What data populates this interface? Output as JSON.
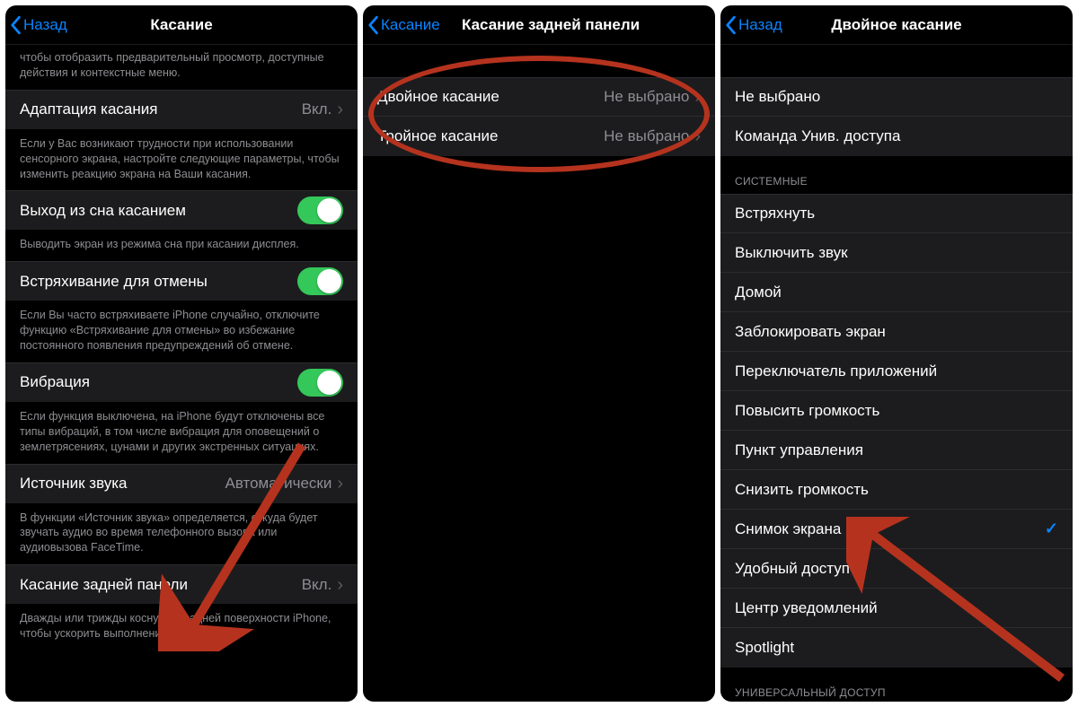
{
  "screen1": {
    "back": "Назад",
    "title": "Касание",
    "topFooter": "чтобы отобразить предварительный просмотр, доступные действия и контекстные меню.",
    "items": [
      {
        "label": "Адаптация касания",
        "value": "Вкл.",
        "footer": "Если у Вас возникают трудности при использовании сенсорного экрана, настройте следующие параметры, чтобы изменить реакцию экрана на Ваши касания."
      },
      {
        "label": "Выход из сна касанием",
        "toggle": true,
        "footer": "Выводить экран из режима сна при касании дисплея."
      },
      {
        "label": "Встряхивание для отмены",
        "toggle": true,
        "footer": "Если Вы часто встряхиваете iPhone случайно, отключите функцию «Встряхивание для отмены» во избежание постоянного появления предупреждений об отмене."
      },
      {
        "label": "Вибрация",
        "toggle": true,
        "footer": "Если функция выключена, на iPhone будут отключены все типы вибраций, в том числе вибрация для оповещений о землетрясениях, цунами и других экстренных ситуациях."
      },
      {
        "label": "Источник звука",
        "value": "Автоматически",
        "footer": "В функции «Источник звука» определяется, откуда будет звучать аудио во время телефонного вызова или аудиовызова FaceTime."
      },
      {
        "label": "Касание задней панели",
        "value": "Вкл.",
        "footer": "Дважды или трижды коснуться задней поверхности iPhone, чтобы ускорить выполнение действий."
      }
    ]
  },
  "screen2": {
    "back": "Касание",
    "title": "Касание задней панели",
    "items": [
      {
        "label": "Двойное касание",
        "value": "Не выбрано"
      },
      {
        "label": "Тройное касание",
        "value": "Не выбрано"
      }
    ]
  },
  "screen3": {
    "back": "Назад",
    "title": "Двойное касание",
    "group1": [
      {
        "label": "Не выбрано"
      },
      {
        "label": "Команда Унив. доступа"
      }
    ],
    "systemHeader": "СИСТЕМНЫЕ",
    "system": [
      {
        "label": "Встряхнуть"
      },
      {
        "label": "Выключить звук"
      },
      {
        "label": "Домой"
      },
      {
        "label": "Заблокировать экран"
      },
      {
        "label": "Переключатель приложений"
      },
      {
        "label": "Повысить громкость"
      },
      {
        "label": "Пункт управления"
      },
      {
        "label": "Снизить громкость"
      },
      {
        "label": "Снимок экрана",
        "checked": true
      },
      {
        "label": "Удобный доступ"
      },
      {
        "label": "Центр уведомлений"
      },
      {
        "label": "Spotlight"
      }
    ],
    "accessHeader": "УНИВЕРСАЛЬНЫЙ ДОСТУП"
  }
}
